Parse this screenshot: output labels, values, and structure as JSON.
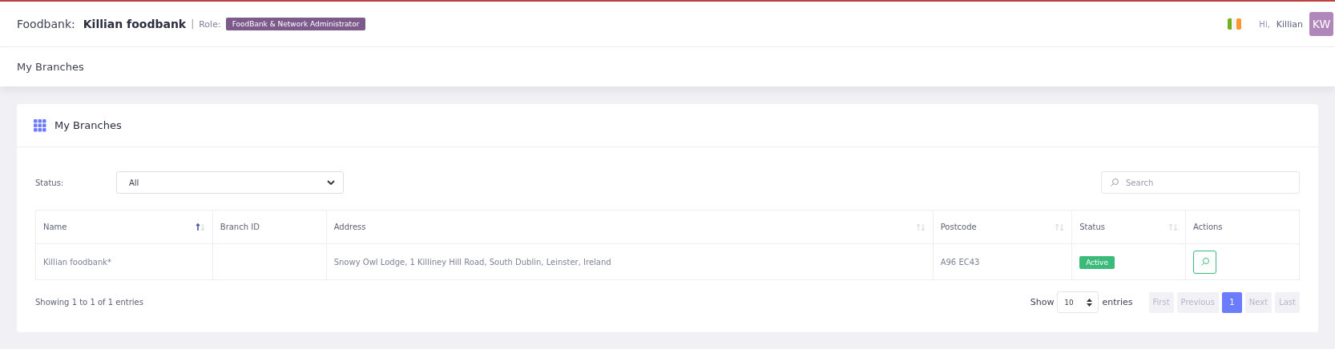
{
  "header": {
    "foodbank_label": "Foodbank:",
    "foodbank_name": "Killian foodbank",
    "separator": "|",
    "role_label": "Role:",
    "role_badge": "FoodBank & Network Administrator",
    "greeting": "Hi,",
    "user_name": "Killian",
    "avatar_initials": "KW"
  },
  "page_title": "My Branches",
  "card": {
    "title": "My Branches",
    "filter": {
      "label": "Status:",
      "value": "All"
    },
    "search": {
      "placeholder": "Search"
    },
    "table": {
      "columns": [
        {
          "label": "Name",
          "sortable": true,
          "sorted": true
        },
        {
          "label": "Branch ID",
          "sortable": false
        },
        {
          "label": "Address",
          "sortable": true,
          "sorted": false
        },
        {
          "label": "Postcode",
          "sortable": true,
          "sorted": false
        },
        {
          "label": "Status",
          "sortable": true,
          "sorted": false
        },
        {
          "label": "Actions",
          "sortable": false
        }
      ],
      "rows": [
        {
          "name": "Killian foodbank*",
          "address": "Snowy Owl Lodge, 1 Killiney Hill Road, South Dublin, Leinster, Ireland",
          "postcode": "A96 EC43",
          "status": "Active",
          "color": "#3cba7a"
        }
      ]
    },
    "info": "Showing 1 to 1 of 1 entries",
    "length": {
      "show": "Show",
      "value": "10",
      "entries": "entries"
    },
    "pagination": [
      {
        "label": "First",
        "selected": false
      },
      {
        "label": "Previous",
        "selected": false
      },
      {
        "label": "1",
        "selected": true
      },
      {
        "label": "Next",
        "selected": false
      },
      {
        "label": "Last",
        "selected": false
      }
    ]
  }
}
